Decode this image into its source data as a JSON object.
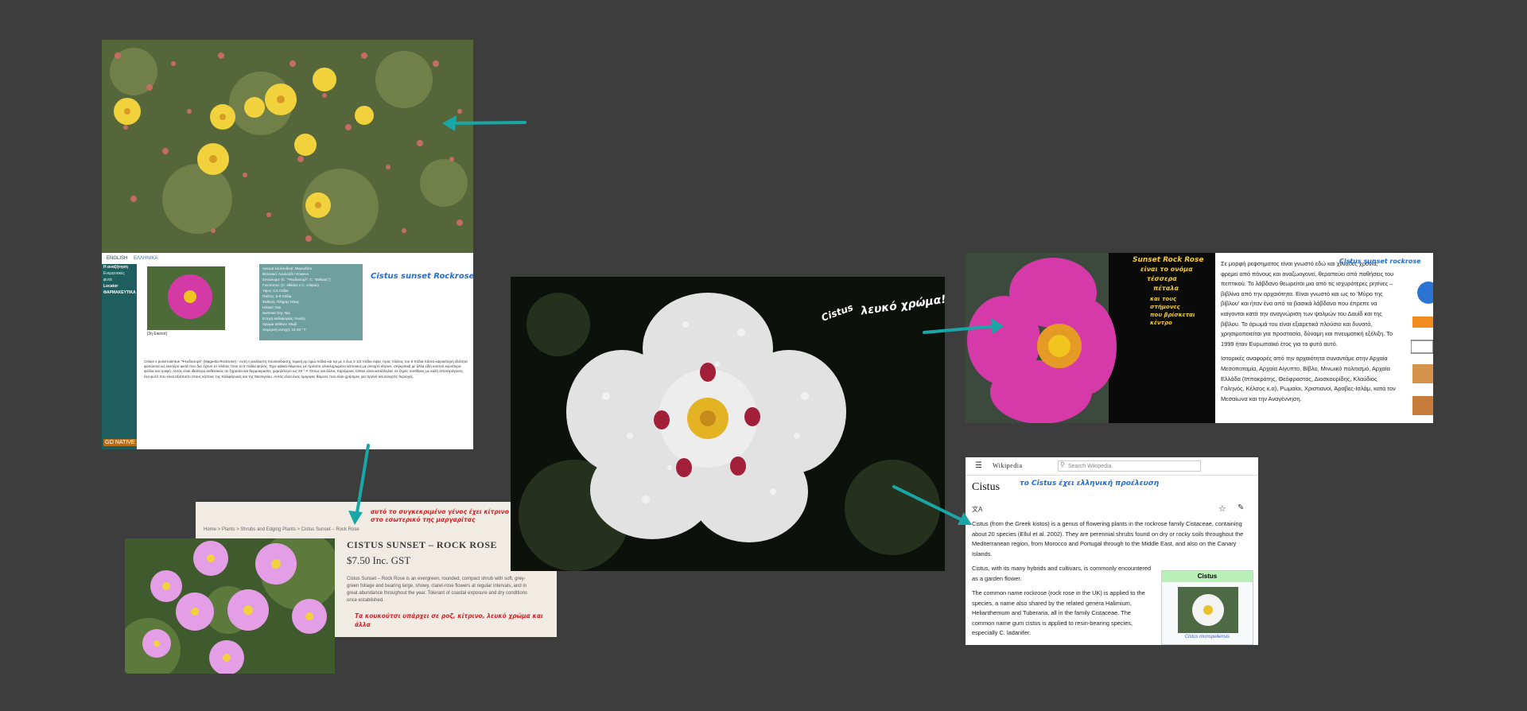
{
  "panel1": {
    "tabs": [
      "ENGLISH",
      "ΕΛΛΗΝΙΚΑ"
    ],
    "left_menu": [
      "Η αναζήτηση",
      "Ενεργειακές",
      "φυτά",
      "Locator",
      "ΦΑΡΜΑΚΕΥΤΙΚΑ"
    ],
    "left_footer": "GO NATIVE",
    "thumb_caption": "[3η Εικόνα]",
    "info_lines": [
      "Αρωμα λουλουδιού: Μυρωδάτο",
      "Βοτανικό: Λουλούδι / Κόκκινο",
      "Συνώνυμα: (C. \"Ψευδοσυρλ\", C. \"Βεΐκαος\")",
      "Γονοτυπια: (C. albidus x C. crispus)",
      "Υψος: 0.5 πόδια",
      "Πλάτος: 6-8 πόδια",
      "Έκθεση: Πλήρης Ήλιος",
      "Ηλιακό: Ναι",
      "Summer Dry: Ναι",
      "Εποχή ανθοφορίας: Άνοιξη",
      "Χρώμα ανθέων: Μωβ",
      "Χειμερινή αντοχή: 15-20 ° F"
    ],
    "annotation": "Cistus sunset Rockrose",
    "body_text": "Cistus x pulverulentus \"Ψευδοσυρλ\" (Magenta Rockrose) - Αυτή η ακόλαστη πουλούδιασης τομική ρρ τιμώ πόδια και τιρ με 2 έως 2 1/2 πόδια ύψος προς πλάτος του 8 πόδια πάντα καιρικότερη ιδιότητα φυσώνται ως εκειτέρο φυτά που δεν έχουν το πλάτος ποιο το 5 πόδια ψηλός. Έχει φιλικά θάμνους με πρόσιτο ολοκληρωμένο κάποιους με ανοιχτό κίτρινο, συγκριτικά με άλλα είδη κισσού κυριότερα φύλλα και τροφή. Αυτός είναι ιδιαίτερα ανθεκτικός σε ξηρασία και θερμοκρασίες χαμηλότερο ως 20 ° F. Όπως και άλλος παρόμοιος Cistus είναι κατάλληλος σε ξηρές συνθήκες με καλή αποστράγγιση, ένα φυτό που είναι αξιόπιστο στους κήπους της Καλιφόρνιας και της Μεσογείου. Αυτός είναι ένας όμορφος θάμνος που είναι χρήσιμος για πρανή και ανοιχτές περιοχές."
  },
  "panel2": {
    "breadcrumb": [
      "Home",
      "Plants",
      "Shrubs and Edging Plants",
      "Cistus Sunset – Rock Rose"
    ],
    "title": "CISTUS SUNSET – ROCK ROSE",
    "price": "$7.50 Inc. GST",
    "description": "Cistus Sunset – Rock Rose is an evergreen, rounded, compact shrub with soft, grey-green foliage and bearing large, showy, claret-rose flowers at regular intervals, and in great abundance throughout the year. Tolerant of coastal exposure and dry conditions once established.",
    "annotation_top": "αυτό το συγκεκριμένο γένος έχει κίτρινο χρώμα στο εσωτερικό της μαργαρίτας",
    "annotation_bottom": "Τα κουκούτσι υπάρχει σε ροζ, κίτρινο, λευκό χρώμα και άλλα"
  },
  "panel3": {
    "annotation_line1": "Cistus",
    "annotation_line2": "λευκό χρώμα!"
  },
  "panel4": {
    "annotation_title": "Cistus sunset rockrose",
    "photo_annotation": [
      "Sunset Rock Rose",
      "είναι το ονόμα",
      "τέσσερα",
      "πέταλα",
      "και τους",
      "στήμονες",
      "που βρίσκεται",
      "κέντρο"
    ],
    "paragraph1": "Σε μορφή ρεφσηματος είναι γνωστό εδώ και χιλιάδες χρόνια, φρεμεί από πόνους και αναζωογονεί, θεραπεύει από παθήσεις του πεπτικού. Το λάβδανο θεωρείται μια από τις ισχυρότερες ρητίνες – βιβλίνα από την αρχαιότητα. Είναι γνωστό και ως το 'Μύρο της βίβλου' και ήταν ένα από τα βασικά λάβδανα που έπρεπε να καίγονται κατά την αναγνώριση των ψαλμών του Δαυίδ και της βίβλου. Το άρωμά του είναι εξαιρετικά πλούσιο και δυνατό, χρησιμοποιείται για προστασία, δύναμη και πνευματική εξέλιξη. Το 1999 ήταν Ευρωπαϊκό έτος για το φυτό αυτό.",
    "paragraph2": "Ιστορικές αναφορές από την αρχαιότητα συναντάμε στην Αρχαία Μεσοποταμία, Αρχαία Αίγυπτο, Βίβλο, Μινωικό πολιτισμό, Αρχαία Ελλάδα (Ιπποκράτης, Θεόφραστος, Διοσκουρίδης, Κλαύδιος Γαληνός, Κέλσος κ.α), Ρωμαίοι, Χριστιανοί, Άραβες-Ισλάμ, κατά τον Μεσαίωνα και την Αναγέννηση."
  },
  "panel5": {
    "brand": "Wikipedia",
    "search_placeholder": "Search Wikipedia",
    "title": "Cistus",
    "annotation": "το Cistus έχει ελληνική προέλευση",
    "lang": "文A",
    "p1": "Cistus (from the Greek kistos) is a genus of flowering plants in the rockrose family Cistaceae, containing about 20 species (Ellul et al. 2002). They are perennial shrubs found on dry or rocky soils throughout the Mediterranean region, from Morocco and Portugal through to the Middle East, and also on the Canary Islands.",
    "p2": "Cistus, with its many hybrids and cultivars, is commonly encountered as a garden flower.",
    "p3": "The common name rockrose (rock rose in the UK) is applied to the species, a name also shared by the related genera Halimium, Helianthemum and Tuberaria, all in the family Cistaceae. The common name gum cistus is applied to resin-bearing species, especially C. ladanifer.",
    "infobox_title": "Cistus",
    "infobox_caption": "Cistus monspeliensis"
  },
  "colors": {
    "background": "#3d3d3d",
    "arrow": "#19a6a6",
    "handwriting_blue": "#1e6fd9",
    "handwriting_yellow": "#f2cc2b",
    "handwriting_red": "#d8232a"
  }
}
